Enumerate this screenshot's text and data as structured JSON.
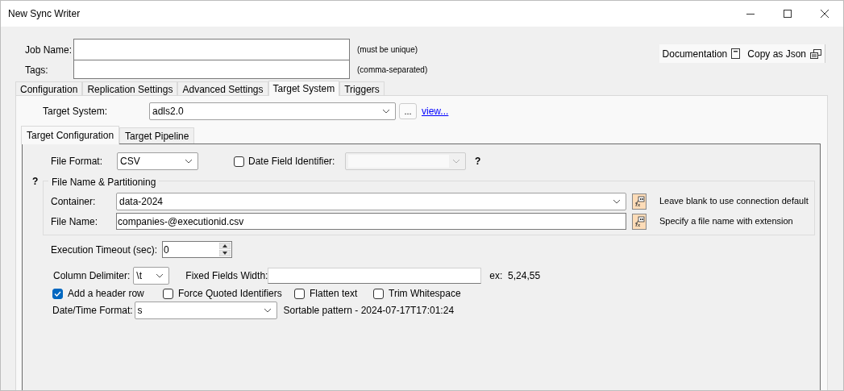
{
  "window": {
    "title": "New Sync Writer"
  },
  "job_fields": [
    {
      "label": "Job Name:",
      "note": "(must be unique)"
    },
    {
      "label": "Tags:",
      "note": "(comma-separated)"
    }
  ],
  "header_buttons": [
    {
      "kind": "documentation",
      "label": "Documentation"
    },
    {
      "kind": "copy",
      "label": "Copy as Json"
    }
  ],
  "tabs": [
    {
      "label": "Configuration",
      "selected": false
    },
    {
      "label": "Replication Settings",
      "selected": false
    },
    {
      "label": "Advanced Settings",
      "selected": false
    },
    {
      "label": "Target System",
      "selected": true
    },
    {
      "label": "Triggers",
      "selected": false
    }
  ],
  "target_system": {
    "label": "Target System:",
    "value": "adls2.0",
    "browse_button": "...",
    "link": "view..."
  },
  "inner_tabs": [
    {
      "label": "Target Configuration",
      "selected": true
    },
    {
      "label": "Target Pipeline",
      "selected": false
    }
  ],
  "file_format": {
    "label": "File Format:",
    "value": "CSV"
  },
  "date_field": {
    "label": "Date Field Identifier:",
    "checked": false,
    "disabled": true,
    "help": "?"
  },
  "partitioning": {
    "help": "?",
    "title": "File Name & Partitioning",
    "fields": [
      {
        "kind": "combo",
        "label": "Container:",
        "value": "data-2024",
        "hint": "Leave blank to use connection default"
      },
      {
        "kind": "text",
        "label": "File Name:",
        "value": "companies-@executionid.csv",
        "hint": "Specify a file name with extension"
      }
    ]
  },
  "execution_timeout": {
    "label": "Execution Timeout (sec):",
    "value": "0"
  },
  "column_delimiter": {
    "label": "Column Delimiter:",
    "value": "\\t"
  },
  "fixed_fields_width": {
    "label": "Fixed Fields Width:",
    "example": "ex:  5,24,55"
  },
  "options": [
    {
      "label": "Add a header row",
      "checked": true
    },
    {
      "label": "Force Quoted Identifiers",
      "checked": false
    },
    {
      "label": "Flatten text",
      "checked": false
    },
    {
      "label": "Trim Whitespace",
      "checked": false
    }
  ],
  "datetime_format": {
    "label": "Date/Time Format:",
    "value": "s",
    "description": "Sortable pattern - 2024-07-17T17:01:24"
  }
}
